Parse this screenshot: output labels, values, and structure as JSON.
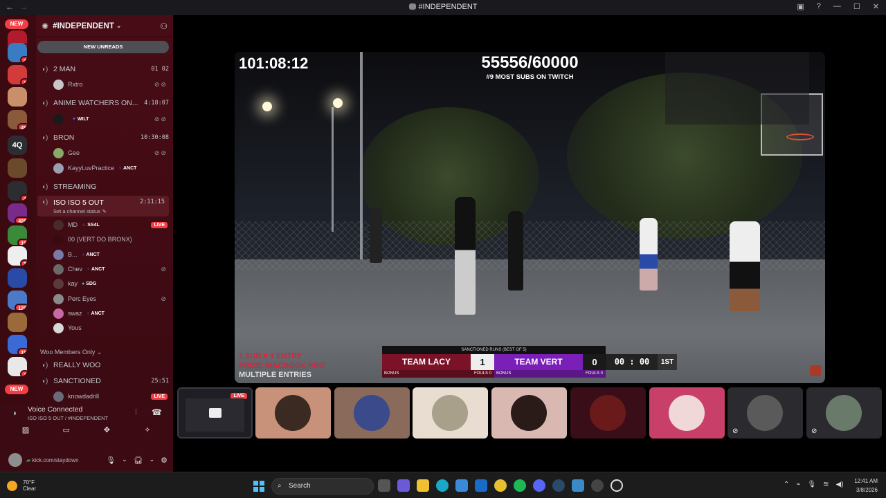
{
  "window": {
    "title": "#INDEPENDENT",
    "back": "←",
    "forward": "→"
  },
  "servers": {
    "new_top": "NEW",
    "new_bottom": "NEW",
    "badges": [
      "4",
      "4",
      "1",
      "48",
      "4",
      "426",
      "19",
      "3",
      "129",
      "15",
      "1"
    ],
    "text_server": "4Q"
  },
  "sidebar": {
    "server_name": "#INDEPENDENT",
    "new_unreads": "NEW UNREADS",
    "channels": [
      {
        "name": "2 MAN",
        "right": "01  02"
      },
      {
        "name": "ANIME WATCHERS ON...",
        "right": "4:18:07"
      },
      {
        "name": "BRON",
        "right": "10:30:08"
      },
      {
        "name": "STREAMING",
        "right": ""
      },
      {
        "name": "ISO ISO 5 OUT",
        "right": "2:11:15",
        "status": "Set a channel status"
      },
      {
        "name": "REALLY WOO",
        "right": ""
      },
      {
        "name": "SANCTIONED",
        "right": "25:51"
      }
    ],
    "users": {
      "rxtro": "Rxtro",
      "wilt": "WILT",
      "gee": "Gee",
      "kayy": "KayyLuvPractice",
      "kayy_tag": "ANCT",
      "md": "MD",
      "md_tag": "SS4L",
      "vert": "00 (VERT DO BRONX)",
      "b": "B...",
      "b_tag": "ANCT",
      "chev": "Chev",
      "chev_tag": "ANCT",
      "kay": "kay",
      "kay_tag": "SDG",
      "perc": "Perc Eyes",
      "swaz": "swaz",
      "swaz_tag": "ANCT",
      "yous": "Yous",
      "knowdadrill": "knowdadrill"
    },
    "live": "LIVE",
    "category": "Woo Members Only"
  },
  "voice": {
    "status": "Voice Connected",
    "location": "ISO ISO 5 OUT / #INDEPENDENT",
    "user_status": "kick.com/staydown"
  },
  "stream": {
    "timer": "101:08:12",
    "subs": "55556/60000",
    "rank": "#9 MOST SUBS ON TWITCH",
    "entry1": "1 SUB = 1 ENTRY",
    "entry2": "PRIZE: MACBOOK PRO",
    "entry3": "MULTIPLE ENTRIES",
    "scoreboard": {
      "title": "SANCTIONED RUNS (BEST OF 5)",
      "team_a": "TEAM LACY",
      "score_a": "1",
      "team_b": "TEAM VERT",
      "score_b": "0",
      "clock": "00 : 00",
      "period": "1ST",
      "bonus": "BONUS",
      "fouls_a": "FOULS  0",
      "fouls_b": "FOULS  0"
    }
  },
  "thumbs": {
    "live": "LIVE"
  },
  "taskbar": {
    "temp": "70°F",
    "weather": "Clear",
    "search": "Search",
    "time": "12:41 AM",
    "date": "3/8/2026"
  },
  "colors": {
    "accent": "#f23f43",
    "sidebar": "#480c16",
    "team_a": "#7b1228",
    "team_b": "#7a1fb8"
  }
}
